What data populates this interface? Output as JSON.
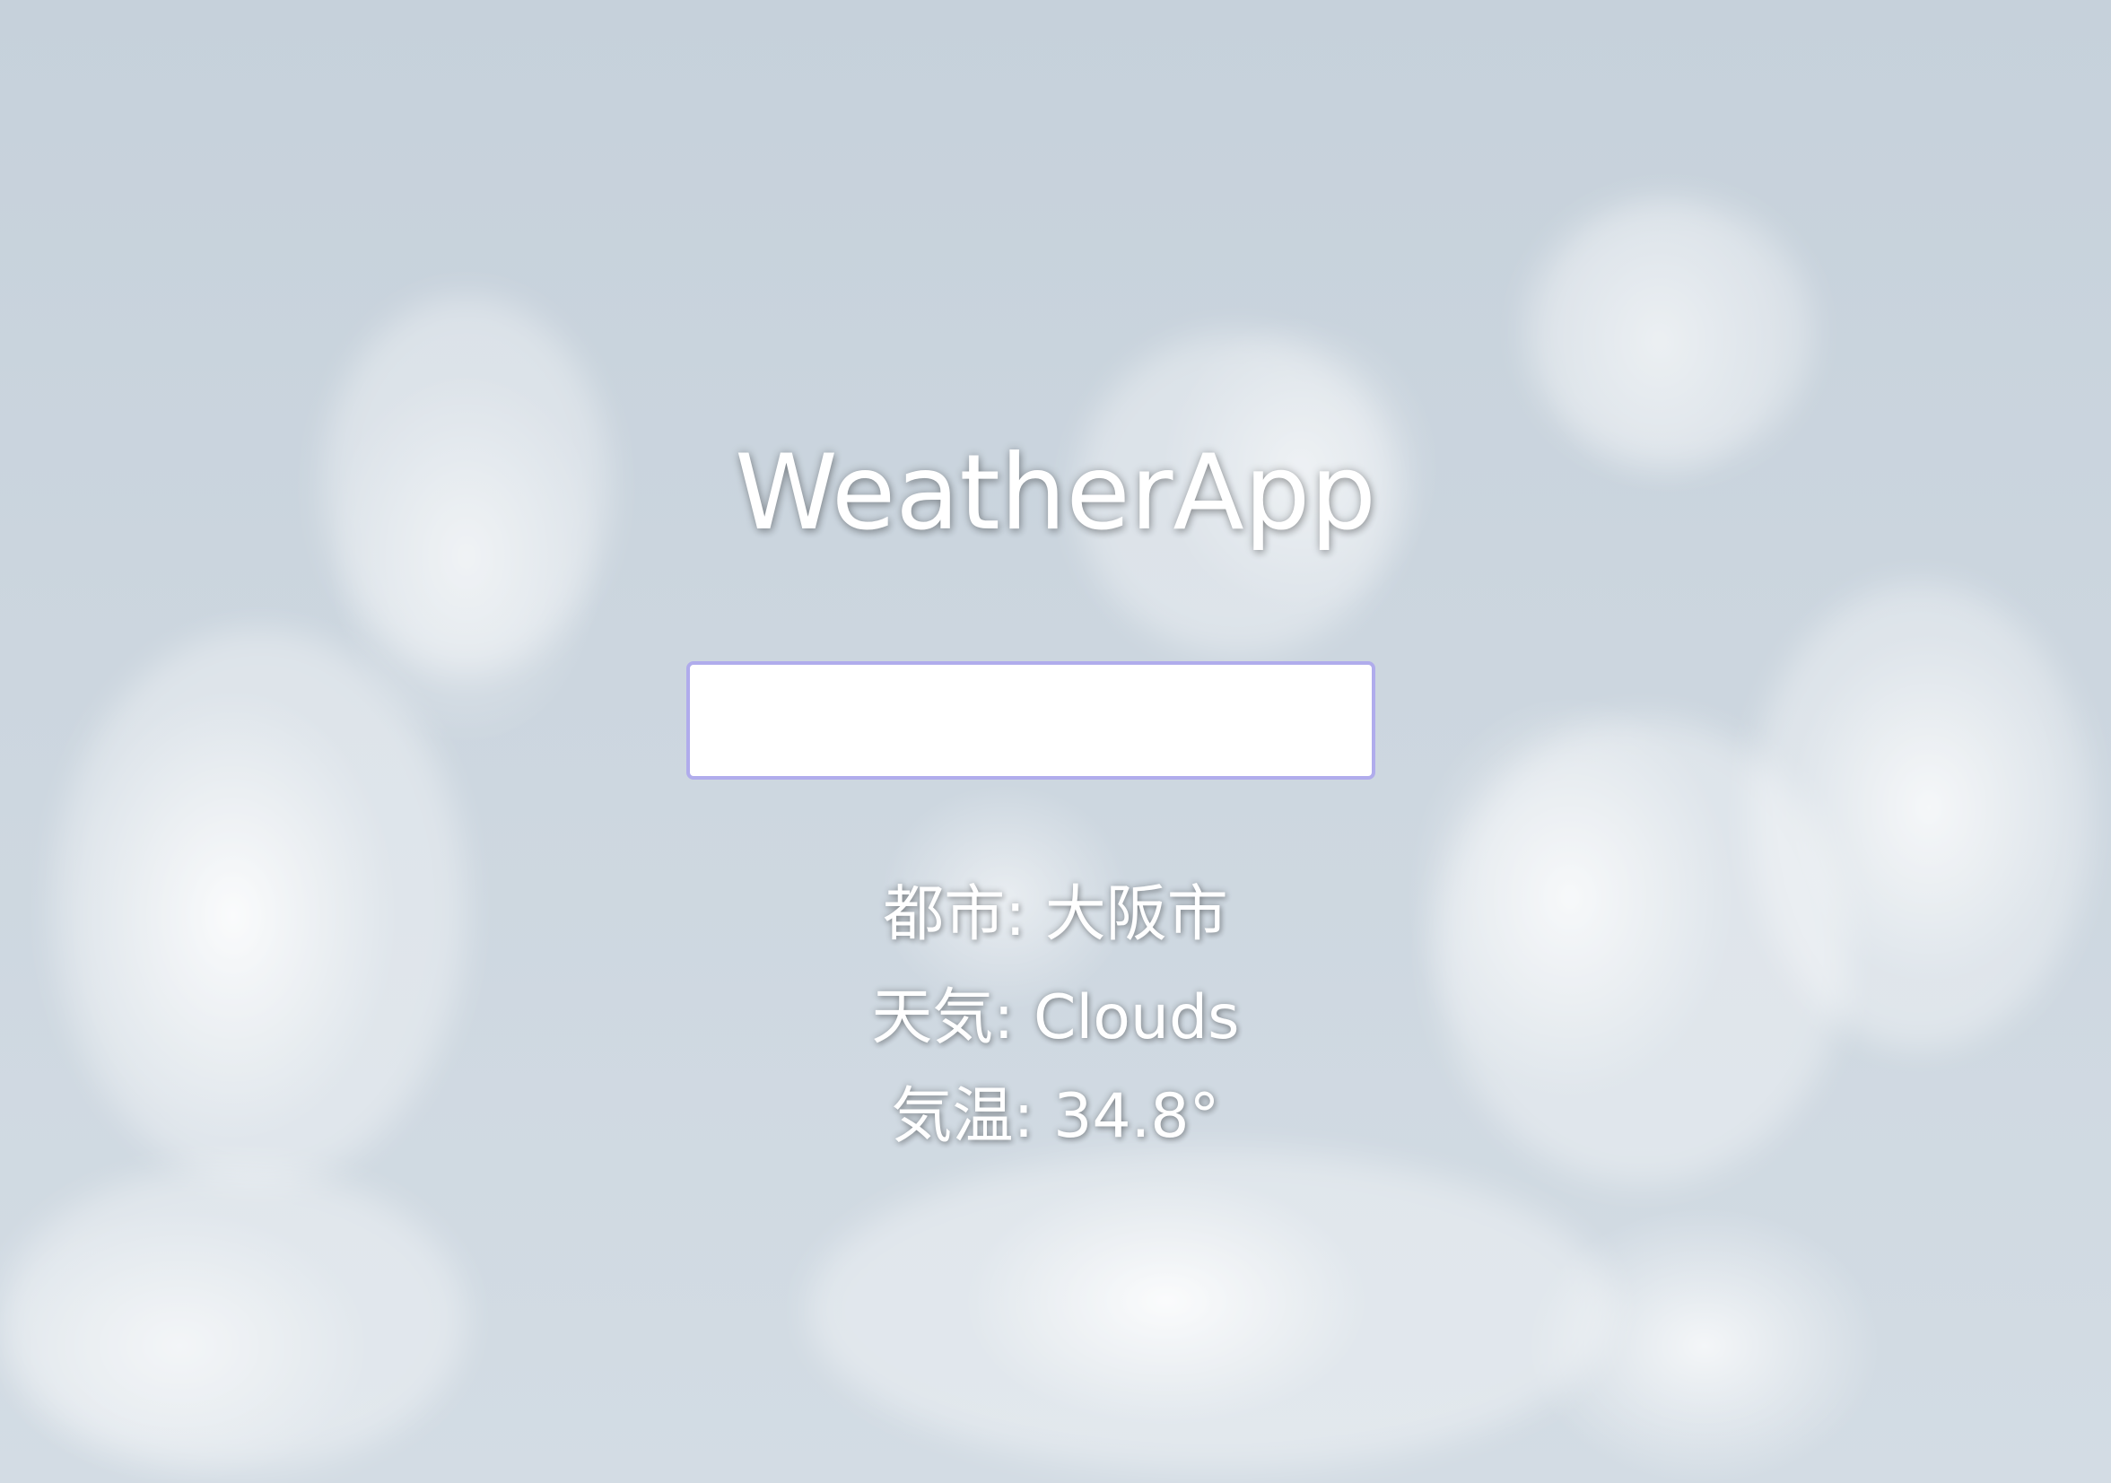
{
  "app": {
    "title": "WeatherApp"
  },
  "search": {
    "value": "",
    "placeholder": ""
  },
  "result": {
    "city_label": "都市",
    "city_value": "大阪市",
    "weather_label": "天気",
    "weather_value": "Clouds",
    "temp_label": "気温",
    "temp_value": "34.8°",
    "separator": ": "
  },
  "colors": {
    "input_border": "#b0acec",
    "text": "#ffffff",
    "sky": "#c6d1db"
  }
}
